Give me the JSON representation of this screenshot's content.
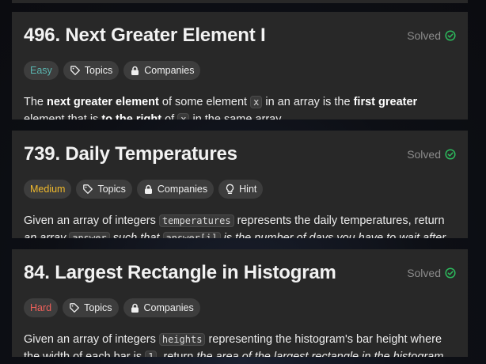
{
  "colors": {
    "card_bg": "#282828",
    "solved_check": "#2cbb5d",
    "easy": "#5bb5b0",
    "medium": "#f0b92c",
    "hard": "#f0605a"
  },
  "problems": [
    {
      "title": "496. Next Greater Element I",
      "status": "Solved",
      "difficulty": "Easy",
      "tags": [
        "Topics",
        "Companies"
      ],
      "desc": {
        "t1": "The ",
        "b1": "next greater element",
        "t2": " of some element ",
        "c1": "x",
        "t3": " in an array is the ",
        "b2": "first greater",
        "t4": " element that is ",
        "b3": "to the right",
        "t5": " of ",
        "c2": "x",
        "t6": " in the same array."
      }
    },
    {
      "title": "739. Daily Temperatures",
      "status": "Solved",
      "difficulty": "Medium",
      "tags": [
        "Topics",
        "Companies",
        "Hint"
      ],
      "desc": {
        "t1": "Given an array of integers ",
        "c1": "temperatures",
        "t2": " represents the daily temperatures, return ",
        "i1": "an array ",
        "c2": "answer",
        "i2": " such that ",
        "c3": "answer[i]",
        "i3": " is the number of days you have to wait after"
      }
    },
    {
      "title": "84. Largest Rectangle in Histogram",
      "status": "Solved",
      "difficulty": "Hard",
      "tags": [
        "Topics",
        "Companies"
      ],
      "desc": {
        "t1": "Given an array of integers ",
        "c1": "heights",
        "t2": " representing the histogram's bar height where the width of each bar is ",
        "c2": "1",
        "t3": ", return ",
        "i1": "the area of the largest rectangle in the histogram"
      }
    }
  ]
}
